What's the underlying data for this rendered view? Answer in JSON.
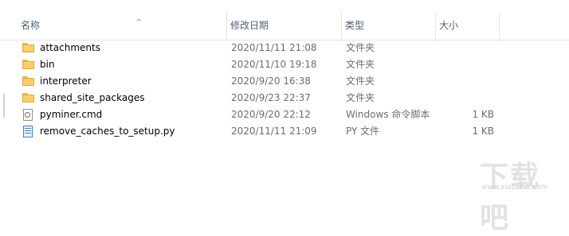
{
  "header": {
    "name": "名称",
    "date": "修改日期",
    "type": "类型",
    "size": "大小",
    "sort_arrow": "^"
  },
  "rows": [
    {
      "icon": "folder-icon",
      "name": "attachments",
      "date": "2020/11/11 21:08",
      "type": "文件夹",
      "size": ""
    },
    {
      "icon": "folder-icon",
      "name": "bin",
      "date": "2020/11/10 19:18",
      "type": "文件夹",
      "size": ""
    },
    {
      "icon": "folder-icon",
      "name": "interpreter",
      "date": "2020/9/20 16:38",
      "type": "文件夹",
      "size": ""
    },
    {
      "icon": "folder-icon",
      "name": "shared_site_packages",
      "date": "2020/9/23 22:37",
      "type": "文件夹",
      "size": ""
    },
    {
      "icon": "cmd-file-icon",
      "name": "pyminer.cmd",
      "date": "2020/9/20 22:12",
      "type": "Windows 命令脚本",
      "size": "1 KB"
    },
    {
      "icon": "python-file-icon",
      "name": "remove_caches_to_setup.py",
      "date": "2020/11/11 21:09",
      "type": "PY 文件",
      "size": "1 KB"
    }
  ],
  "watermark": {
    "text": "下载吧",
    "url": "www.xiazaiba.com"
  }
}
